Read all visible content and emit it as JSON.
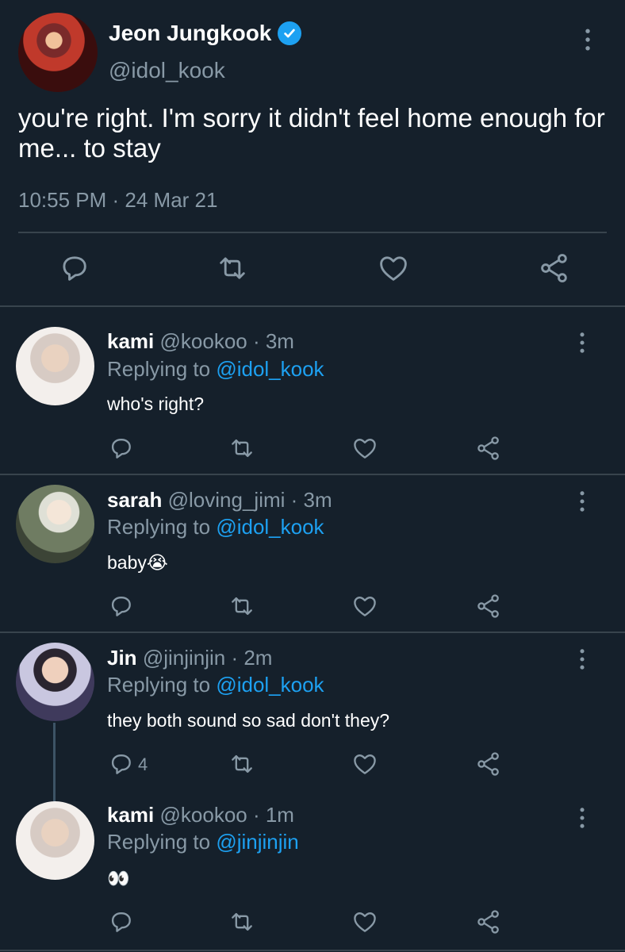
{
  "main_tweet": {
    "display_name": "Jeon Jungkook",
    "handle": "@idol_kook",
    "text": "you're right. I'm sorry it didn't feel home enough for me... to stay",
    "timestamp": "10:55 PM · 24 Mar 21",
    "verified": true,
    "actions": [
      "reply-icon",
      "retweet-icon",
      "like-icon",
      "share-icon"
    ]
  },
  "replies": [
    {
      "display_name": "kami",
      "meta": "@kookoo · 3m",
      "replying_prefix": "Replying to",
      "replying_to": "@idol_kook",
      "text": "who's right?",
      "reply_count": ""
    },
    {
      "display_name": "sarah",
      "meta": "@loving_jimi · 3m",
      "replying_prefix": "Replying to",
      "replying_to": "@idol_kook",
      "text": "baby😭",
      "reply_count": ""
    },
    {
      "display_name": "Jin",
      "meta": "@jinjinjin · 2m",
      "replying_prefix": "Replying to",
      "replying_to": "@idol_kook",
      "text": "they both sound so sad don't they?",
      "reply_count": "4"
    },
    {
      "display_name": "kami",
      "meta": "@kookoo · 1m",
      "replying_prefix": "Replying to",
      "replying_to": "@jinjinjin",
      "text": "👀",
      "reply_count": ""
    }
  ],
  "colors": {
    "background": "#15202b",
    "secondary_text": "#8899a6",
    "link": "#1da1f2",
    "divider": "#38444d"
  }
}
